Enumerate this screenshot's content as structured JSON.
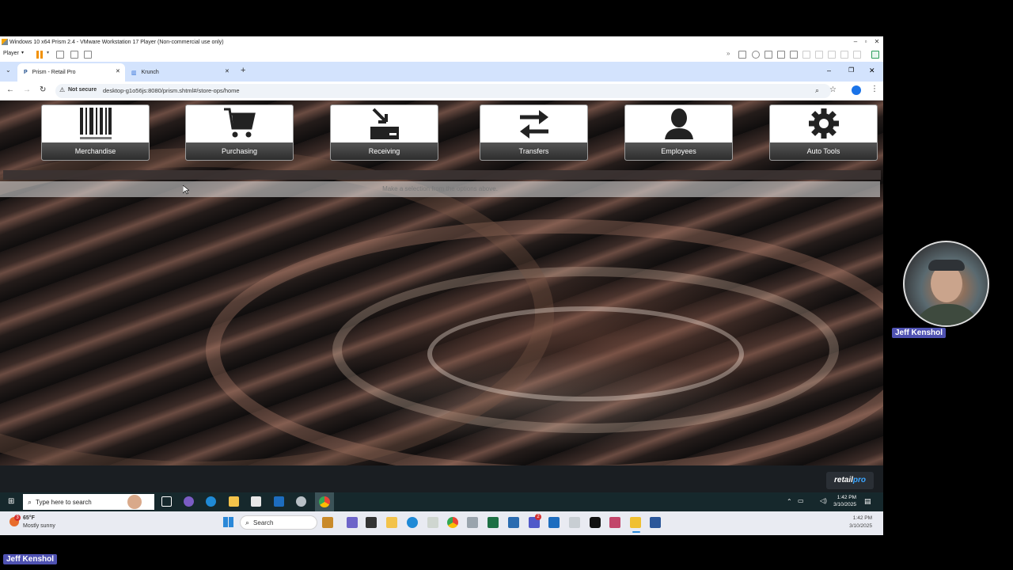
{
  "vmware": {
    "title": "Windows 10 x64 Prism 2.4 - VMware Workstation 17 Player (Non-commercial use only)",
    "player_menu": "Player"
  },
  "chrome": {
    "tabs": [
      {
        "label": "Prism - Retail Pro",
        "active": true
      },
      {
        "label": "Krunch",
        "active": false
      }
    ],
    "security_label": "Not secure",
    "url": "desktop-g1o56js:8080/prism.shtml#/store-ops/home"
  },
  "store_ops": {
    "buttons": [
      {
        "label": "Merchandise",
        "icon": "barcode-icon"
      },
      {
        "label": "Purchasing",
        "icon": "shopping-cart-icon"
      },
      {
        "label": "Receiving",
        "icon": "receiving-icon"
      },
      {
        "label": "Transfers",
        "icon": "transfer-arrows-icon"
      },
      {
        "label": "Employees",
        "icon": "person-icon"
      },
      {
        "label": "Auto Tools",
        "icon": "gear-icon"
      }
    ],
    "status_message": "Make a selection from the options above."
  },
  "brand": {
    "logo_main": "retail",
    "logo_accent": "pro",
    "accent_color": "#3ba6ff"
  },
  "guest_taskbar": {
    "search_placeholder": "Type here to search",
    "time": "1:42 PM",
    "date": "3/10/2025"
  },
  "host_taskbar": {
    "weather_temp": "65°F",
    "weather_desc": "Mostly sunny",
    "weather_badge": "3",
    "search_label": "Search",
    "teams_badge": "2",
    "time": "1:42 PM",
    "date": "3/10/2025"
  },
  "participant": {
    "name": "Jeff Kenshol"
  }
}
